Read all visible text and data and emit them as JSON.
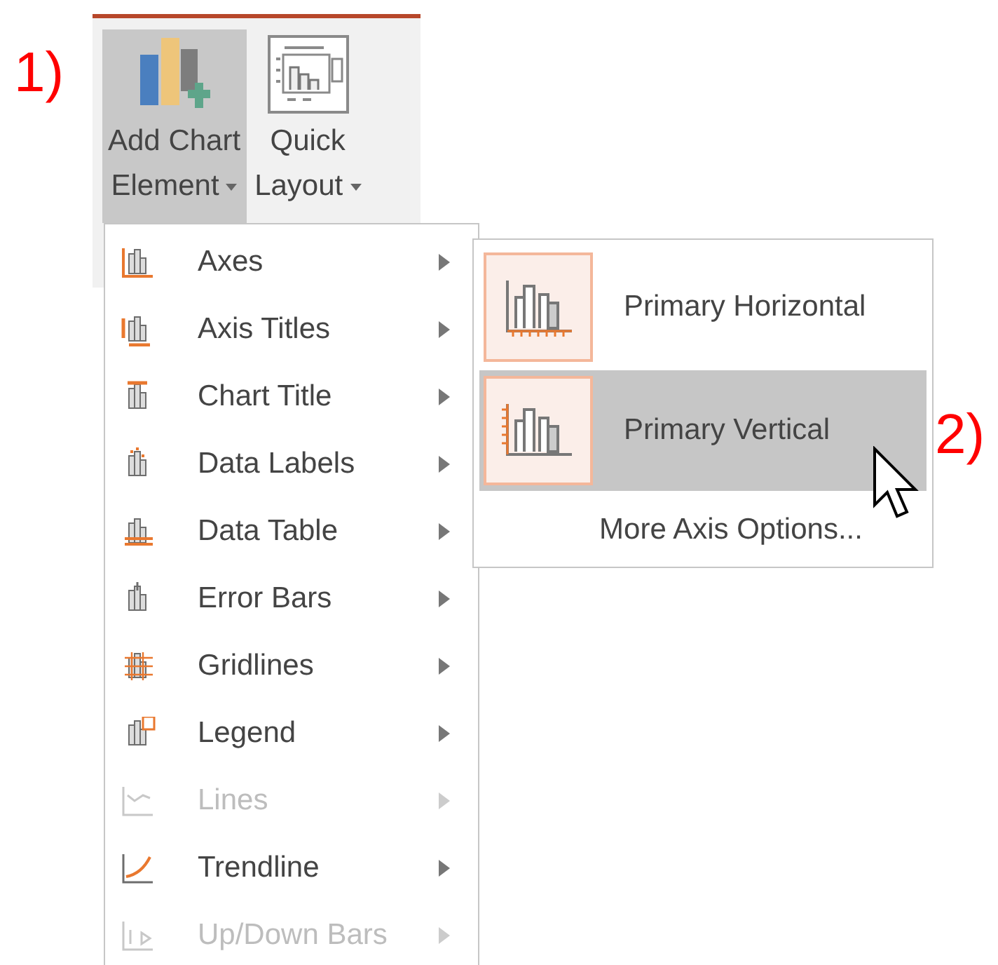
{
  "annotations": [
    {
      "label": "1)"
    },
    {
      "label": "2)"
    }
  ],
  "ribbon": {
    "buttons": [
      {
        "label_lines": [
          "Add Chart",
          "Element"
        ],
        "selected": true
      },
      {
        "label_lines": [
          "Quick",
          "Layout"
        ],
        "selected": false
      }
    ]
  },
  "menu": {
    "items": [
      {
        "label": "Axes",
        "disabled": false
      },
      {
        "label": "Axis Titles",
        "disabled": false
      },
      {
        "label": "Chart Title",
        "disabled": false
      },
      {
        "label": "Data Labels",
        "disabled": false
      },
      {
        "label": "Data Table",
        "disabled": false
      },
      {
        "label": "Error Bars",
        "disabled": false
      },
      {
        "label": "Gridlines",
        "disabled": false
      },
      {
        "label": "Legend",
        "disabled": false
      },
      {
        "label": "Lines",
        "disabled": true
      },
      {
        "label": "Trendline",
        "disabled": false
      },
      {
        "label": "Up/Down Bars",
        "disabled": true
      }
    ]
  },
  "submenu": {
    "items": [
      {
        "kind": "option",
        "label": "Primary Horizontal",
        "selected": false
      },
      {
        "kind": "option",
        "label": "Primary Vertical",
        "selected": true
      },
      {
        "kind": "link",
        "label": "More Axis Options..."
      }
    ]
  }
}
